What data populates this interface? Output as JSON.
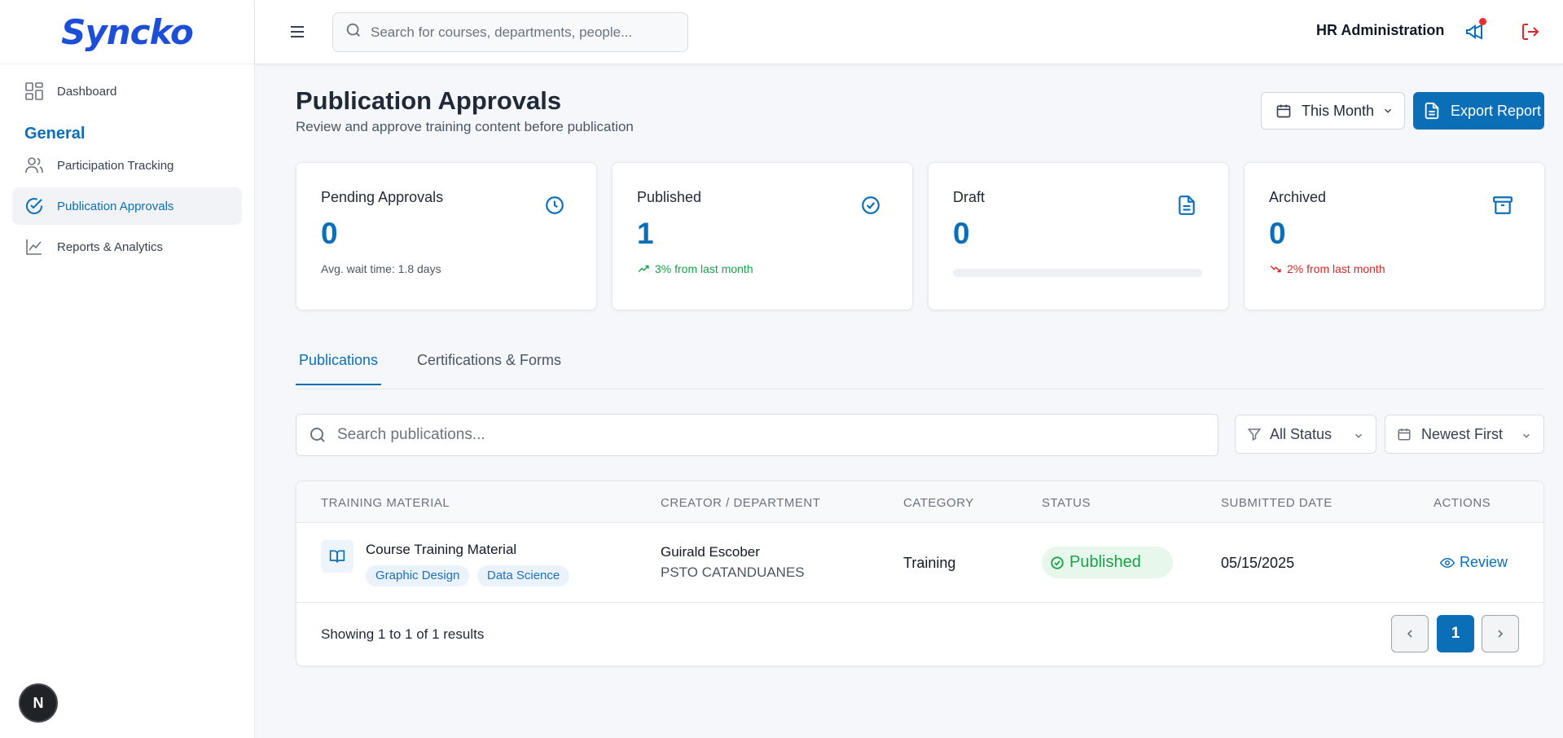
{
  "app": {
    "logo": "Syncko"
  },
  "sidebar": {
    "items": [
      {
        "label": "Dashboard",
        "icon": "grid-icon"
      },
      {
        "label": "Participation Tracking",
        "icon": "users-icon"
      },
      {
        "label": "Publication Approvals",
        "icon": "check-circle-icon",
        "active": true
      },
      {
        "label": "Reports & Analytics",
        "icon": "chart-line-icon"
      }
    ],
    "section_label": "General",
    "dev_badge": "N"
  },
  "topbar": {
    "search_placeholder": "Search for courses, departments, people...",
    "user_role": "HR Administration",
    "notification_dot_color": "#ef2b2b"
  },
  "page": {
    "title": "Publication Approvals",
    "subtitle": "Review and approve training content before publication",
    "date_filter": "This Month",
    "export_label": "Export Report"
  },
  "stats": [
    {
      "title": "Pending Approvals",
      "value": "0",
      "footer": "Avg. wait time: 1.8 days",
      "icon": "clock-icon"
    },
    {
      "title": "Published",
      "value": "1",
      "footer": "3% from last month",
      "trend": "up",
      "icon": "check-circle-icon"
    },
    {
      "title": "Draft",
      "value": "0",
      "progress": 0,
      "icon": "document-icon"
    },
    {
      "title": "Archived",
      "value": "0",
      "footer": "2% from last month",
      "trend": "down",
      "icon": "archive-icon"
    }
  ],
  "tabs": [
    {
      "label": "Publications",
      "active": true
    },
    {
      "label": "Certifications & Forms"
    }
  ],
  "filters": {
    "search_placeholder": "Search publications...",
    "status": "All Status",
    "sort": "Newest First"
  },
  "table": {
    "columns": [
      "TRAINING MATERIAL",
      "CREATOR / DEPARTMENT",
      "CATEGORY",
      "STATUS",
      "SUBMITTED DATE",
      "ACTIONS"
    ],
    "rows": [
      {
        "title": "Course Training Material",
        "tags": [
          "Graphic Design",
          "Data Science"
        ],
        "creator": "Guirald Escober",
        "department": "PSTO CATANDUANES",
        "category": "Training",
        "status": "Published",
        "submitted": "05/15/2025",
        "action": "Review"
      }
    ],
    "showing": "Showing 1 to 1 of 1 results",
    "current_page": "1"
  },
  "colors": {
    "accent": "#0b6fb8",
    "success": "#16a34a",
    "danger": "#dc2626"
  }
}
